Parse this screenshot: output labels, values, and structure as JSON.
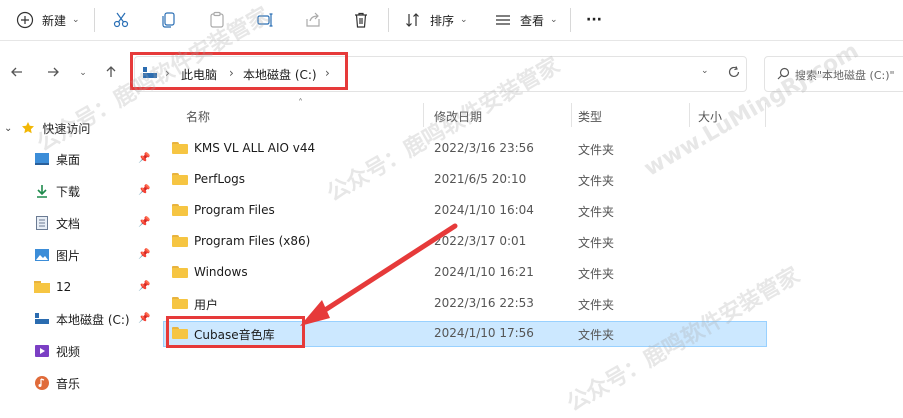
{
  "toolbar": {
    "new_label": "新建",
    "sort_label": "排序",
    "view_label": "查看",
    "more_label": "···"
  },
  "address": {
    "crumbs": [
      "此电脑",
      "本地磁盘 (C:)"
    ],
    "search_placeholder": "搜索\"本地磁盘 (C:)\""
  },
  "sidebar": {
    "items": [
      {
        "label": "快速访问",
        "icon": "star-icon",
        "pinned": false
      },
      {
        "label": "桌面",
        "icon": "desktop-icon",
        "pinned": true
      },
      {
        "label": "下载",
        "icon": "download-icon",
        "pinned": true
      },
      {
        "label": "文档",
        "icon": "document-icon",
        "pinned": true
      },
      {
        "label": "图片",
        "icon": "picture-icon",
        "pinned": true
      },
      {
        "label": "12",
        "icon": "folder-icon",
        "pinned": true
      },
      {
        "label": "本地磁盘 (C:)",
        "icon": "drive-icon",
        "pinned": true
      },
      {
        "label": "视频",
        "icon": "video-icon",
        "pinned": false
      },
      {
        "label": "音乐",
        "icon": "music-icon",
        "pinned": false
      }
    ]
  },
  "columns": {
    "name": "名称",
    "date": "修改日期",
    "type": "类型",
    "size": "大小"
  },
  "files": [
    {
      "name": "KMS VL ALL AIO v44",
      "date": "2022/3/16 23:56",
      "type": "文件夹"
    },
    {
      "name": "PerfLogs",
      "date": "2021/6/5 20:10",
      "type": "文件夹"
    },
    {
      "name": "Program Files",
      "date": "2024/1/10 16:04",
      "type": "文件夹"
    },
    {
      "name": "Program Files (x86)",
      "date": "2022/3/17 0:01",
      "type": "文件夹"
    },
    {
      "name": "Windows",
      "date": "2024/1/10 16:21",
      "type": "文件夹"
    },
    {
      "name": "用户",
      "date": "2022/3/16 22:53",
      "type": "文件夹"
    },
    {
      "name": "Cubase音色库",
      "date": "2024/1/10 17:56",
      "type": "文件夹"
    }
  ],
  "watermark": {
    "text_a": "公众号：鹿鸣软件安装管家",
    "text_b": "www.LuMingRJ.com"
  },
  "colors": {
    "accent_red": "#e63a3a",
    "selection": "#cce8ff",
    "folder": "#f6c542"
  }
}
